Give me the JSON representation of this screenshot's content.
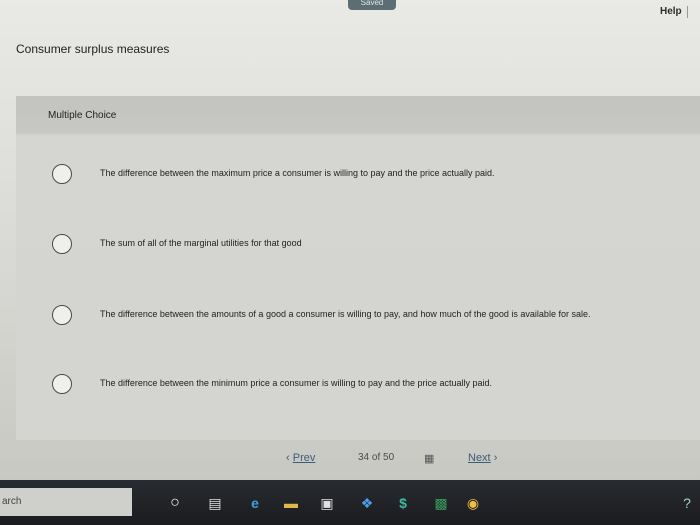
{
  "header": {
    "saved_label": "Saved",
    "help_label": "Help"
  },
  "page": {
    "title": "Consumer surplus measures"
  },
  "question": {
    "type_label": "Multiple Choice",
    "options": [
      "The difference between the maximum price a consumer is willing to pay and the price actually paid.",
      "The sum of all of the marginal utilities for that good",
      "The difference between the amounts of a good a consumer is willing to pay, and how much of the good is available for sale.",
      "The difference between the minimum price a consumer is willing to pay and the price actually paid."
    ]
  },
  "pager": {
    "prev_label": "Prev",
    "current": "34",
    "of_label": "of",
    "total": "50",
    "next_label": "Next"
  },
  "taskbar": {
    "search_text": "arch"
  }
}
